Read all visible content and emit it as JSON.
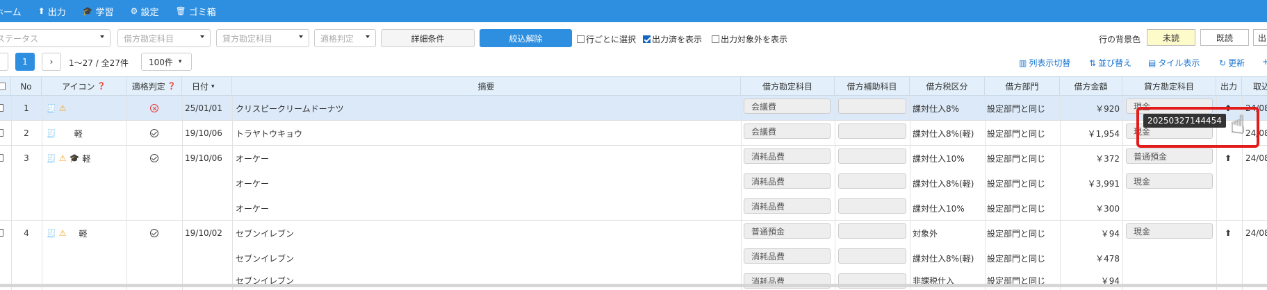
{
  "nav": {
    "items": [
      {
        "label": "ホーム",
        "icon": "home-icon"
      },
      {
        "label": "出力",
        "icon": "upload-icon"
      },
      {
        "label": "学習",
        "icon": "graduation-cap-icon"
      },
      {
        "label": "設定",
        "icon": "gear-icon"
      },
      {
        "label": "ゴミ箱",
        "icon": "trash-icon"
      }
    ]
  },
  "filters": {
    "status_placeholder": "ステータス",
    "debit_account_placeholder": "借方勘定科目",
    "credit_account_placeholder": "貸方勘定科目",
    "eligibility_placeholder": "適格判定",
    "detail_button": "詳細条件",
    "clear_button": "絞込解除",
    "select_per_row": "行ごとに選択",
    "show_exported": "出力済を表示",
    "show_excluded": "出力対象外を表示",
    "row_bg_label": "行の背景色",
    "bg_unread": "未読",
    "bg_read": "既読",
    "bg_partial": "出"
  },
  "pager": {
    "current_page": "1",
    "range_text": "1〜27 / 全27件",
    "per_page": "100件",
    "column_switch": "列表示切替",
    "sort": "並び替え",
    "tile_view": "タイル表示",
    "refresh": "更新"
  },
  "table": {
    "headers": {
      "no": "No",
      "icon": "アイコン",
      "eligibility": "適格判定",
      "date": "日付",
      "summary": "摘要",
      "debit_account": "借方勘定科目",
      "debit_sub": "借方補助科目",
      "debit_tax": "借方税区分",
      "debit_dept": "借方部門",
      "debit_amount": "借方金額",
      "credit_account": "貸方勘定科目",
      "output": "出力",
      "transaction": "取込"
    },
    "rows": [
      {
        "no": "1",
        "date": "25/01/01",
        "reduced": "",
        "lines": [
          {
            "summary": "クリスピークリームドーナツ",
            "account": "会議費",
            "tax": "課対仕入8%",
            "dept": "設定部門と同じ",
            "amount": "￥920",
            "credit": "現金"
          }
        ],
        "tx": "24/08"
      },
      {
        "no": "2",
        "date": "19/10/06",
        "reduced": "軽",
        "lines": [
          {
            "summary": "トラヤトウキョウ",
            "account": "会議費",
            "tax": "課対仕入8%(軽)",
            "dept": "設定部門と同じ",
            "amount": "￥1,954",
            "credit": "現金"
          }
        ],
        "tx": "24/08"
      },
      {
        "no": "3",
        "date": "19/10/06",
        "reduced": "軽",
        "lines": [
          {
            "summary": "オーケー",
            "account": "消耗品費",
            "tax": "課対仕入10%",
            "dept": "設定部門と同じ",
            "amount": "￥372",
            "credit": "普通預金"
          },
          {
            "summary": "オーケー",
            "account": "消耗品費",
            "tax": "課対仕入8%(軽)",
            "dept": "設定部門と同じ",
            "amount": "￥3,991",
            "credit": "現金"
          },
          {
            "summary": "オーケー",
            "account": "消耗品費",
            "tax": "課対仕入10%",
            "dept": "設定部門と同じ",
            "amount": "￥300",
            "credit": ""
          }
        ],
        "tx": "24/08"
      },
      {
        "no": "4",
        "date": "19/10/02",
        "reduced": "軽",
        "lines": [
          {
            "summary": "セブンイレブン",
            "account": "普通預金",
            "tax": "対象外",
            "dept": "設定部門と同じ",
            "amount": "￥94",
            "credit": "現金"
          },
          {
            "summary": "セブンイレブン",
            "account": "消耗品費",
            "tax": "課対仕入8%(軽)",
            "dept": "設定部門と同じ",
            "amount": "￥478",
            "credit": ""
          },
          {
            "summary": "セブンイレブン",
            "account": "消耗品費",
            "tax": "非課税仕入",
            "dept": "設定部門と同じ",
            "amount": "￥94",
            "credit": ""
          }
        ],
        "tx": "24/08"
      }
    ]
  },
  "tooltip": {
    "text": "20250327144454"
  },
  "colors": {
    "primary": "#2e8fe0",
    "header_bg": "#e3f0fb",
    "highlight_row": "#dce9f8",
    "warning": "#f5a623",
    "error": "#e53935",
    "annotation": "#e21b1b",
    "unread_bg": "#fdfbc9"
  }
}
